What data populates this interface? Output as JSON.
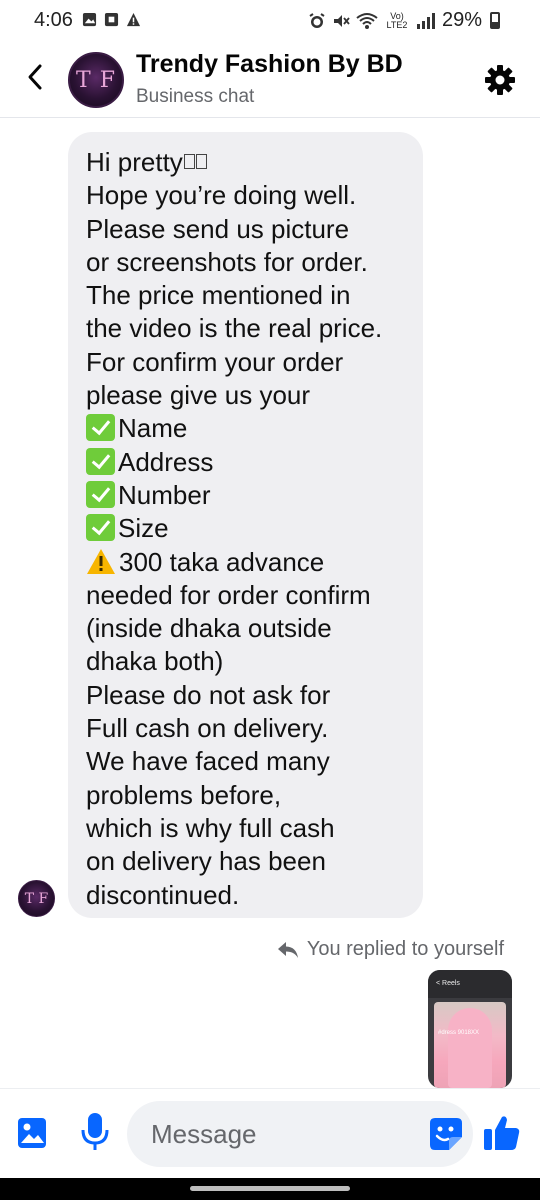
{
  "status_bar": {
    "time": "4:06",
    "battery": "29%",
    "network": "Vo) LTE2"
  },
  "header": {
    "title": "Trendy Fashion By BD",
    "subtitle": "Business chat",
    "avatar_monogram": "T F"
  },
  "thread": {
    "message": {
      "lines": [
        "Hi pretty",
        "Hope you’re doing well.",
        "Please send us picture",
        "or screenshots for order.",
        "The price mentioned in",
        "the video is the real price.",
        "For confirm your order",
        "please give us your",
        "Name",
        "Address",
        "Number",
        "Size",
        "300 taka advance",
        "needed for order confirm",
        "(inside dhaka outside",
        "dhaka both)",
        "Please do not ask for",
        "Full cash on delivery.",
        "We have faced many",
        "problems before,",
        "which is why full cash",
        "on delivery has been",
        "discontinued."
      ],
      "checklist_icon": "check-mark-emoji",
      "warning_icon": "warning-emoji"
    },
    "reply": {
      "label": "You replied to yourself",
      "thumbnail": {
        "header_text": "< Reels",
        "caption": "#dress 9018XX"
      }
    }
  },
  "composer": {
    "placeholder": "Message"
  },
  "colors": {
    "accent": "#0866ff",
    "bubble": "#efeff2",
    "check": "#6fcc3a"
  }
}
